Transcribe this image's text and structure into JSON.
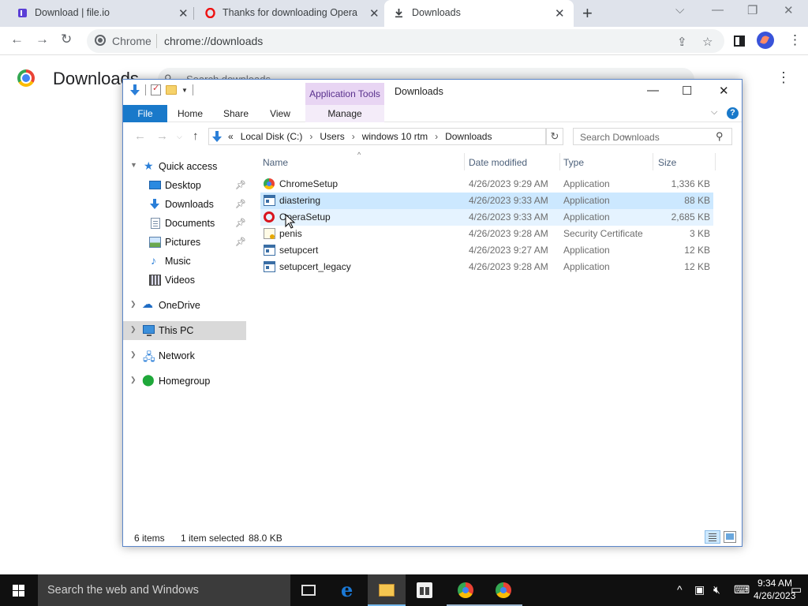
{
  "chrome": {
    "tabs": [
      {
        "title": "Download | file.io",
        "icon": "fileio-icon"
      },
      {
        "title": "Thanks for downloading Opera",
        "icon": "opera-icon"
      },
      {
        "title": "Downloads",
        "icon": "download-icon",
        "active": true
      }
    ],
    "new_tab": "+",
    "window_controls": {
      "dropdown": "⌵",
      "minimize": "—",
      "restore": "❐",
      "close": "✕"
    },
    "nav": {
      "back": "←",
      "forward": "→",
      "reload": "↻"
    },
    "omnibox": {
      "site_label": "Chrome",
      "url": "chrome://downloads"
    },
    "actions": {
      "share": "⇪",
      "bookmark": "☆",
      "menu": "⋮"
    }
  },
  "downloads_page": {
    "heading": "Downloads",
    "search_placeholder": "Search downloads",
    "menu": "⋮"
  },
  "explorer": {
    "title": "Downloads",
    "app_tools_label": "Application Tools",
    "window_controls": {
      "minimize": "—",
      "maximize": "☐",
      "close": "✕"
    },
    "ribbon_tabs": {
      "file": "File",
      "home": "Home",
      "share": "Share",
      "view": "View",
      "manage": "Manage"
    },
    "help": "?",
    "address": {
      "overflow": "«",
      "crumbs": [
        "Local Disk (C:)",
        "Users",
        "windows 10 rtm",
        "Downloads"
      ],
      "separator": "›"
    },
    "search_placeholder": "Search Downloads",
    "nav_pane": [
      {
        "label": "Quick access",
        "icon": "star-icon"
      },
      {
        "label": "Desktop",
        "icon": "desktop-icon",
        "pinned": true
      },
      {
        "label": "Downloads",
        "icon": "download-icon",
        "pinned": true
      },
      {
        "label": "Documents",
        "icon": "documents-icon",
        "pinned": true
      },
      {
        "label": "Pictures",
        "icon": "pictures-icon",
        "pinned": true
      },
      {
        "label": "Music",
        "icon": "music-icon"
      },
      {
        "label": "Videos",
        "icon": "videos-icon"
      },
      {
        "label": "OneDrive",
        "icon": "onedrive-icon"
      },
      {
        "label": "This PC",
        "icon": "this-pc-icon",
        "selected": true
      },
      {
        "label": "Network",
        "icon": "network-icon"
      },
      {
        "label": "Homegroup",
        "icon": "homegroup-icon"
      }
    ],
    "columns": {
      "name": "Name",
      "date": "Date modified",
      "type": "Type",
      "size": "Size"
    },
    "files": [
      {
        "name": "ChromeSetup",
        "date": "4/26/2023 9:29 AM",
        "type": "Application",
        "size": "1,336 KB",
        "icon": "chrome-icon"
      },
      {
        "name": "diastering",
        "date": "4/26/2023 9:33 AM",
        "type": "Application",
        "size": "88 KB",
        "icon": "application-icon",
        "selected": true
      },
      {
        "name": "OperaSetup",
        "date": "4/26/2023 9:33 AM",
        "type": "Application",
        "size": "2,685 KB",
        "icon": "opera-icon",
        "hover": true
      },
      {
        "name": "penis",
        "date": "4/26/2023 9:28 AM",
        "type": "Security Certificate",
        "size": "3 KB",
        "icon": "certificate-icon"
      },
      {
        "name": "setupcert",
        "date": "4/26/2023 9:27 AM",
        "type": "Application",
        "size": "12 KB",
        "icon": "application-icon"
      },
      {
        "name": "setupcert_legacy",
        "date": "4/26/2023 9:28 AM",
        "type": "Application",
        "size": "12 KB",
        "icon": "application-icon"
      }
    ],
    "status": {
      "count": "6 items",
      "selected": "1 item selected",
      "size": "88.0 KB"
    }
  },
  "taskbar": {
    "search_placeholder": "Search the web and Windows",
    "clock_time": "9:34 AM",
    "clock_date": "4/26/2023"
  },
  "colors": {
    "ribbon_file": "#1979ca",
    "app_tools": "#e8d5f3",
    "selection": "#cce8ff",
    "taskbar": "#101010"
  }
}
